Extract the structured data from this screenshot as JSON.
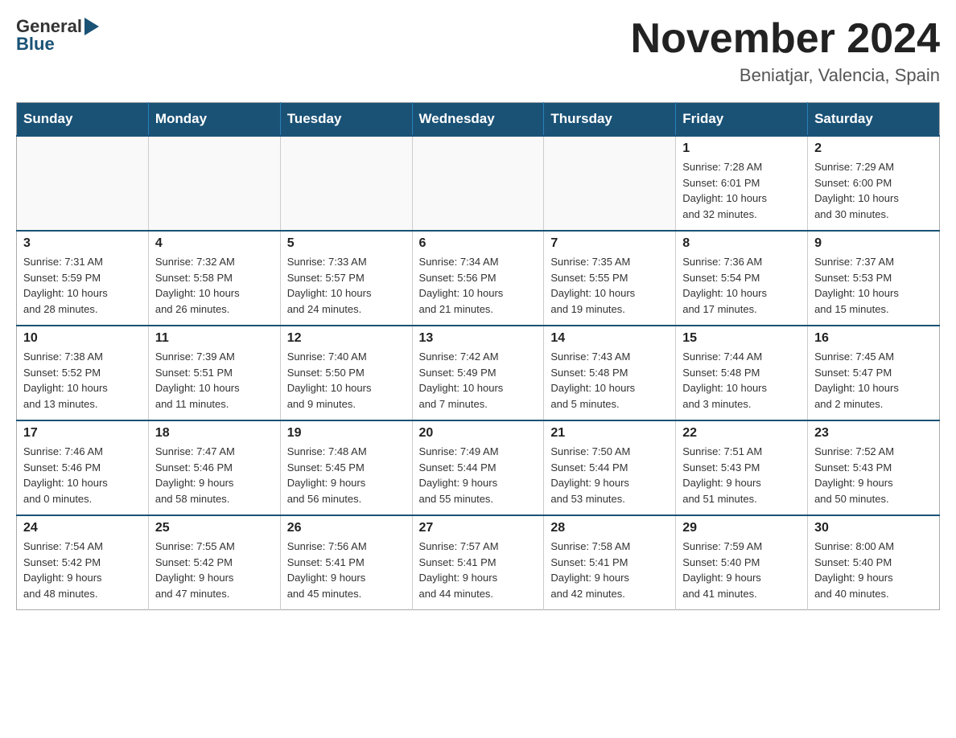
{
  "header": {
    "logo_general": "General",
    "logo_blue": "Blue",
    "month_year": "November 2024",
    "location": "Beniatjar, Valencia, Spain"
  },
  "weekdays": [
    "Sunday",
    "Monday",
    "Tuesday",
    "Wednesday",
    "Thursday",
    "Friday",
    "Saturday"
  ],
  "weeks": [
    [
      {
        "day": "",
        "info": ""
      },
      {
        "day": "",
        "info": ""
      },
      {
        "day": "",
        "info": ""
      },
      {
        "day": "",
        "info": ""
      },
      {
        "day": "",
        "info": ""
      },
      {
        "day": "1",
        "info": "Sunrise: 7:28 AM\nSunset: 6:01 PM\nDaylight: 10 hours\nand 32 minutes."
      },
      {
        "day": "2",
        "info": "Sunrise: 7:29 AM\nSunset: 6:00 PM\nDaylight: 10 hours\nand 30 minutes."
      }
    ],
    [
      {
        "day": "3",
        "info": "Sunrise: 7:31 AM\nSunset: 5:59 PM\nDaylight: 10 hours\nand 28 minutes."
      },
      {
        "day": "4",
        "info": "Sunrise: 7:32 AM\nSunset: 5:58 PM\nDaylight: 10 hours\nand 26 minutes."
      },
      {
        "day": "5",
        "info": "Sunrise: 7:33 AM\nSunset: 5:57 PM\nDaylight: 10 hours\nand 24 minutes."
      },
      {
        "day": "6",
        "info": "Sunrise: 7:34 AM\nSunset: 5:56 PM\nDaylight: 10 hours\nand 21 minutes."
      },
      {
        "day": "7",
        "info": "Sunrise: 7:35 AM\nSunset: 5:55 PM\nDaylight: 10 hours\nand 19 minutes."
      },
      {
        "day": "8",
        "info": "Sunrise: 7:36 AM\nSunset: 5:54 PM\nDaylight: 10 hours\nand 17 minutes."
      },
      {
        "day": "9",
        "info": "Sunrise: 7:37 AM\nSunset: 5:53 PM\nDaylight: 10 hours\nand 15 minutes."
      }
    ],
    [
      {
        "day": "10",
        "info": "Sunrise: 7:38 AM\nSunset: 5:52 PM\nDaylight: 10 hours\nand 13 minutes."
      },
      {
        "day": "11",
        "info": "Sunrise: 7:39 AM\nSunset: 5:51 PM\nDaylight: 10 hours\nand 11 minutes."
      },
      {
        "day": "12",
        "info": "Sunrise: 7:40 AM\nSunset: 5:50 PM\nDaylight: 10 hours\nand 9 minutes."
      },
      {
        "day": "13",
        "info": "Sunrise: 7:42 AM\nSunset: 5:49 PM\nDaylight: 10 hours\nand 7 minutes."
      },
      {
        "day": "14",
        "info": "Sunrise: 7:43 AM\nSunset: 5:48 PM\nDaylight: 10 hours\nand 5 minutes."
      },
      {
        "day": "15",
        "info": "Sunrise: 7:44 AM\nSunset: 5:48 PM\nDaylight: 10 hours\nand 3 minutes."
      },
      {
        "day": "16",
        "info": "Sunrise: 7:45 AM\nSunset: 5:47 PM\nDaylight: 10 hours\nand 2 minutes."
      }
    ],
    [
      {
        "day": "17",
        "info": "Sunrise: 7:46 AM\nSunset: 5:46 PM\nDaylight: 10 hours\nand 0 minutes."
      },
      {
        "day": "18",
        "info": "Sunrise: 7:47 AM\nSunset: 5:46 PM\nDaylight: 9 hours\nand 58 minutes."
      },
      {
        "day": "19",
        "info": "Sunrise: 7:48 AM\nSunset: 5:45 PM\nDaylight: 9 hours\nand 56 minutes."
      },
      {
        "day": "20",
        "info": "Sunrise: 7:49 AM\nSunset: 5:44 PM\nDaylight: 9 hours\nand 55 minutes."
      },
      {
        "day": "21",
        "info": "Sunrise: 7:50 AM\nSunset: 5:44 PM\nDaylight: 9 hours\nand 53 minutes."
      },
      {
        "day": "22",
        "info": "Sunrise: 7:51 AM\nSunset: 5:43 PM\nDaylight: 9 hours\nand 51 minutes."
      },
      {
        "day": "23",
        "info": "Sunrise: 7:52 AM\nSunset: 5:43 PM\nDaylight: 9 hours\nand 50 minutes."
      }
    ],
    [
      {
        "day": "24",
        "info": "Sunrise: 7:54 AM\nSunset: 5:42 PM\nDaylight: 9 hours\nand 48 minutes."
      },
      {
        "day": "25",
        "info": "Sunrise: 7:55 AM\nSunset: 5:42 PM\nDaylight: 9 hours\nand 47 minutes."
      },
      {
        "day": "26",
        "info": "Sunrise: 7:56 AM\nSunset: 5:41 PM\nDaylight: 9 hours\nand 45 minutes."
      },
      {
        "day": "27",
        "info": "Sunrise: 7:57 AM\nSunset: 5:41 PM\nDaylight: 9 hours\nand 44 minutes."
      },
      {
        "day": "28",
        "info": "Sunrise: 7:58 AM\nSunset: 5:41 PM\nDaylight: 9 hours\nand 42 minutes."
      },
      {
        "day": "29",
        "info": "Sunrise: 7:59 AM\nSunset: 5:40 PM\nDaylight: 9 hours\nand 41 minutes."
      },
      {
        "day": "30",
        "info": "Sunrise: 8:00 AM\nSunset: 5:40 PM\nDaylight: 9 hours\nand 40 minutes."
      }
    ]
  ]
}
